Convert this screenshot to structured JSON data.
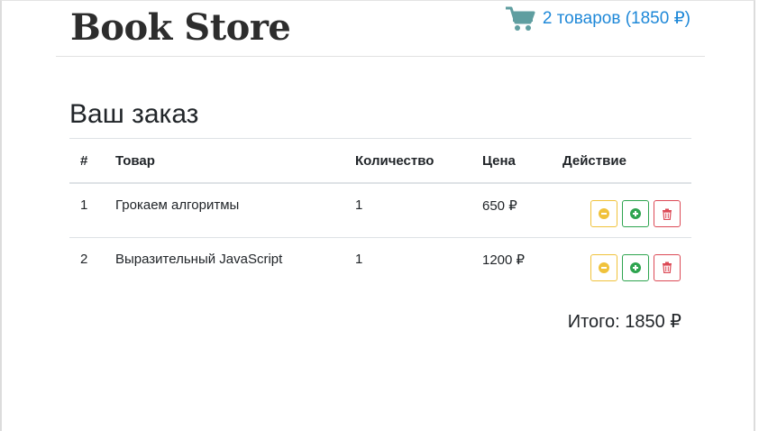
{
  "header": {
    "brand": "Book Store",
    "cart_summary": "2 товаров (1850 ₽)",
    "cart_icon": "shopping-cart-icon"
  },
  "order": {
    "title": "Ваш заказ",
    "columns": [
      "#",
      "Товар",
      "Количество",
      "Цена",
      "Действие"
    ],
    "rows": [
      {
        "num": "1",
        "name": "Грокаем алгоритмы",
        "qty": "1",
        "price": "650 ₽"
      },
      {
        "num": "2",
        "name": "Выразительный JavaScript",
        "qty": "1",
        "price": "1200 ₽"
      }
    ],
    "total": "Итого: 1850 ₽"
  },
  "icons": {
    "decrease": "minus-circle-icon",
    "increase": "plus-circle-icon",
    "remove": "trash-icon"
  },
  "colors": {
    "link": "#1e88d8",
    "cart_icon": "#5f9ea0",
    "warning": "#f0c23b",
    "success": "#2ea44f",
    "danger": "#dc4a56"
  }
}
